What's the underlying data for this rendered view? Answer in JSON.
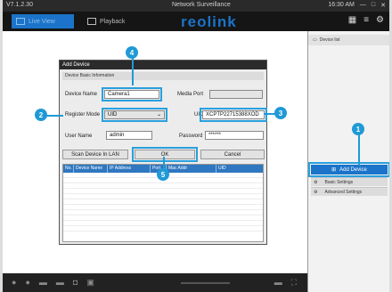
{
  "window": {
    "version": "V7.1.2.30",
    "title": "Network Surveillance",
    "status": "16:30 AM"
  },
  "toolbar": {
    "live_label": "Live View",
    "playback_label": "Playback",
    "logo": "reolink"
  },
  "sidebar": {
    "device_list_label": "Device list",
    "add_device_label": "Add Device",
    "items": [
      {
        "label": "Basic Settings"
      },
      {
        "label": "Advanced Settings"
      }
    ]
  },
  "dialog": {
    "title": "Add Device",
    "section_title": "Device Basic Information",
    "device_name_label": "Device Name",
    "device_name_value": "Camera1",
    "media_port_label": "Media Port",
    "media_port_value": "",
    "register_mode_label": "Register Mode",
    "register_mode_value": "UID",
    "uid_label": "UID",
    "uid_value": "XCPTP22715388XOD",
    "user_name_label": "User Name",
    "user_name_value": "admin",
    "password_label": "Password",
    "password_value": "******",
    "scan_button": "Scan Device In LAN",
    "ok_button": "OK",
    "cancel_button": "Cancel",
    "columns": [
      "No.",
      "Device Name",
      "IP Address",
      "Port",
      "Mac Addr",
      "UID"
    ]
  },
  "callouts": [
    "1",
    "2",
    "3",
    "4",
    "5"
  ],
  "colors": {
    "accent": "#1b74c9",
    "callout": "#1f9ad6",
    "background": "#1c1c1c"
  }
}
